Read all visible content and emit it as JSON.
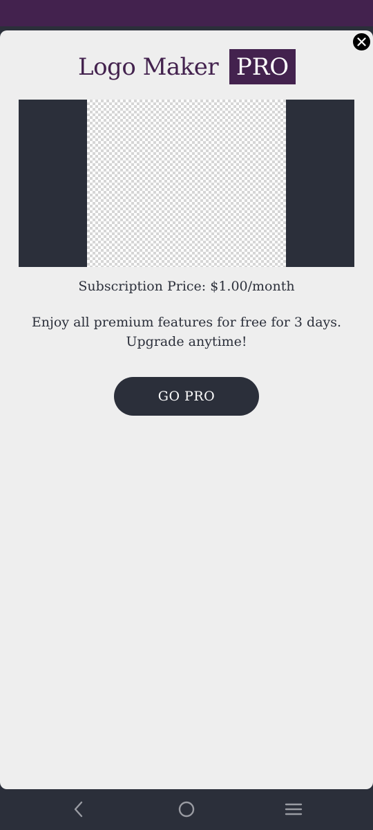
{
  "header": {
    "title": "Logo Maker",
    "badge": "PRO"
  },
  "preview": {
    "description": "transparent logo preview"
  },
  "offer": {
    "price": "Subscription Price: $1.00/month",
    "trial_line1": "Enjoy all premium features for free for 3 days.",
    "trial_line2": "Upgrade anytime!",
    "cta_label": "GO PRO"
  },
  "icons": {
    "close": "close-icon",
    "back": "back-icon",
    "home": "home-icon",
    "recents": "recents-icon"
  },
  "colors": {
    "brand": "#43224e",
    "dark": "#2b2f3a",
    "sheet_bg": "#eeeeee"
  }
}
